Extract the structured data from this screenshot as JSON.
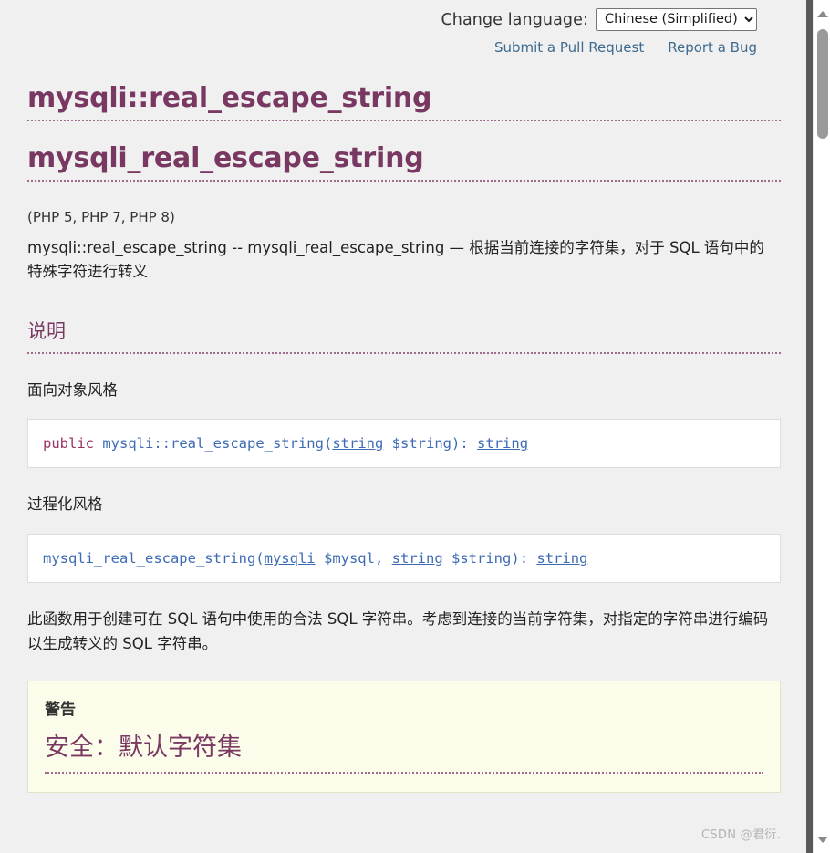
{
  "header": {
    "change_language_label": "Change language:",
    "language_selected": "Chinese (Simplified)",
    "language_options": [
      "Chinese (Simplified)"
    ],
    "submit_pull_request": "Submit a Pull Request",
    "report_a_bug": "Report a Bug"
  },
  "titles": {
    "oop_name": "mysqli::real_escape_string",
    "procedural_name": "mysqli_real_escape_string"
  },
  "versions": "(PHP 5, PHP 7, PHP 8)",
  "refpurpose": "mysqli::real_escape_string -- mysqli_real_escape_string — 根据当前连接的字符集，对于 SQL 语句中的特殊字符进行转义",
  "description": {
    "section_title": "说明",
    "oop_style_label": "面向对象风格",
    "procedural_style_label": "过程化风格",
    "body": "此函数用于创建可在 SQL 语句中使用的合法 SQL 字符串。考虑到连接的当前字符集，对指定的字符串进行编码以生成转义的 SQL 字符串。"
  },
  "synopsis_oop": {
    "modifier": "public",
    "methodname": "mysqli::real_escape_string",
    "open_paren": "(",
    "param_type": "string",
    "param_name": "$string",
    "close_paren": ")",
    "colon": ":",
    "return_type": "string"
  },
  "synopsis_procedural": {
    "methodname": "mysqli_real_escape_string",
    "open_paren": "(",
    "param1_type": "mysqli",
    "param1_name": "$mysql",
    "comma": ",",
    "param2_type": "string",
    "param2_name": "$string",
    "close_paren": ")",
    "colon": ":",
    "return_type": "string"
  },
  "warning": {
    "title": "警告",
    "heading": "安全：默认字符集"
  },
  "scrollbar": {
    "up_arrow": "scroll-up-arrow",
    "down_arrow": "scroll-down-arrow"
  },
  "watermark": "CSDN @君衍.",
  "colors": {
    "heading": "#793862",
    "link": "#3e6a8e",
    "code": "#3d6ab5",
    "modifier": "#993366",
    "page_background": "#f0f0f0",
    "warning_background": "#fcfcea"
  }
}
